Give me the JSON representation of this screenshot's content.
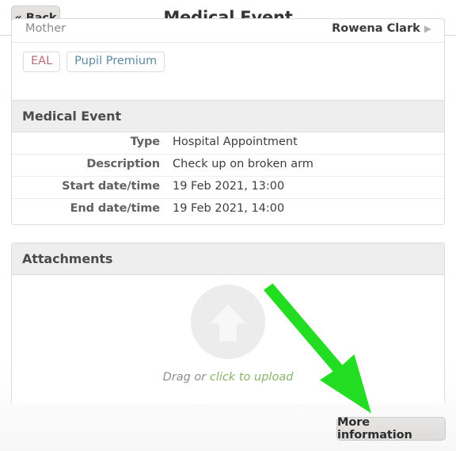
{
  "header": {
    "back_label": "« Back",
    "title": "Medical Event"
  },
  "student_card": {
    "relation_label": "Mother",
    "relation_value": "Rowena Clark",
    "chevron_icon": "chevron-right-icon",
    "tags": [
      {
        "label": "EAL",
        "color": "#ba6d74"
      },
      {
        "label": "Pupil Premium",
        "color": "#5c8aa3"
      }
    ]
  },
  "medical_event": {
    "section_title": "Medical Event",
    "rows": [
      {
        "label": "Type",
        "value": "Hospital Appointment"
      },
      {
        "label": "Description",
        "value": "Check up on broken arm"
      },
      {
        "label": "Start date/time",
        "value": "19 Feb 2021, 13:00"
      },
      {
        "label": "End date/time",
        "value": "19 Feb 2021, 14:00"
      }
    ]
  },
  "attachments": {
    "section_title": "Attachments",
    "upload_icon": "upload-arrow-icon",
    "drag_text": "Drag or ",
    "click_text": "click to upload"
  },
  "footer": {
    "more_information_label": "More information"
  },
  "annotation": {
    "arrow_color": "#22dd22",
    "arrow_icon": "annotation-arrow-icon"
  }
}
